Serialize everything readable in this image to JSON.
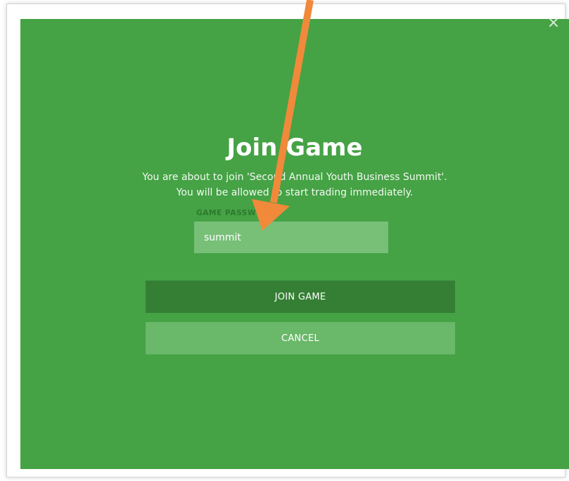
{
  "dialog": {
    "close_glyph": "×",
    "title": "Join Game",
    "description_line1": "You are about to join 'Second Annual Youth Business Summit'.",
    "description_line2": "You will be allowed to start trading immediately.",
    "password_label": "GAME PASSWORD",
    "password_value": "summit",
    "join_button_label": "JOIN GAME",
    "cancel_button_label": "CANCEL"
  },
  "colors": {
    "modal_background": "#45a245",
    "input_background": "#78bf78",
    "join_button": "#357f35",
    "cancel_button": "#6ab86a",
    "annotation_arrow": "#f08a3a"
  },
  "annotation": {
    "icon": "arrow-pointer-icon"
  }
}
